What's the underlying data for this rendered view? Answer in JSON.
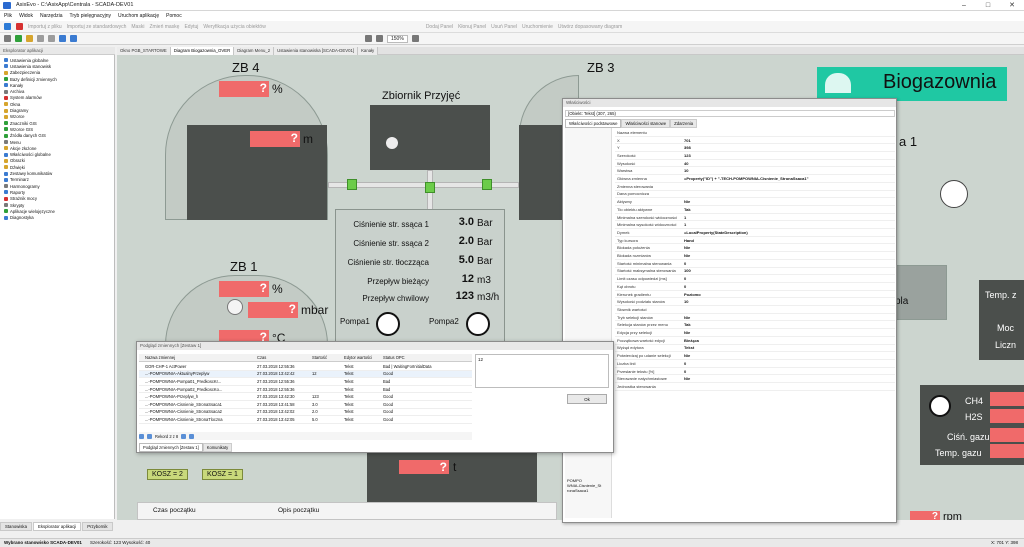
{
  "window": {
    "title": "AsixEvo - C:\\AsixApp\\Centrala - SCADA-DEV01"
  },
  "menu": [
    "Plik",
    "Widok",
    "Narzędzia",
    "Tryb pielęgnacyjny",
    "Uruchom aplikację",
    "Pomoc"
  ],
  "toolbar": {
    "import_from_file": "Importuj z pliku",
    "import_standard": "Importuj ze standardowych",
    "mask": "Maski",
    "change_mask": "Zmień maskę",
    "edit": "Edytuj",
    "verify": "Weryfikacja użycia obiektów",
    "dock_panel": "Dodaj Panel",
    "remove_panel": "Kłonuj Panel",
    "reset_panel": "Usuń Panel",
    "run": "Uruchomienie",
    "add_diagrams": "Utwórz dopasowany diagram",
    "zoom": "150%"
  },
  "left_panel": {
    "header": "Eksplorator aplikacji",
    "items": [
      "Ustawienia globalne",
      "Ustawienia stanowisk",
      "Zabezpieczenia",
      "Bazy definicji zmiennych",
      "Kanały",
      "Archiva",
      "System alarmów",
      "Okna",
      "Diagramy",
      "Wzorce",
      "Znaczniki GIS",
      "Wzorce GIS",
      "Źródła danych GIS",
      "Menu",
      "Akcje złożone",
      "Właściwości globalne",
      "Obrazki",
      "Dźwięki",
      "Zestawy komunikatów",
      "Terminarz",
      "Harmonogramy",
      "Raporty",
      "Strażnik mocy",
      "Skrypty",
      "Aplikacje wielojęzyczne",
      "Diagnostyka"
    ]
  },
  "tabs": [
    "Okno PGB_STARTOWE",
    "Diagram Biogazownia_OVER",
    "Diagram Menu_2",
    "Ustawienia stanowiska [SCADA-DEV01]",
    "Kanały"
  ],
  "scada": {
    "zb4": {
      "title": "ZB 4",
      "v1": "?",
      "u1": "%",
      "v2": "?",
      "u2": "m"
    },
    "zb3": {
      "title": "ZB 3",
      "v1": "?",
      "u1": "%"
    },
    "zb1": {
      "title": "ZB 1",
      "v1": "?",
      "u1": "%",
      "v2": "?",
      "u2": "mbar",
      "v3": "?",
      "u3": "°C"
    },
    "tank_title": "Zbiornik Przyjęć",
    "brand": "Biogazownia",
    "brand_right": "a 1",
    "rows": [
      {
        "label": "Ciśnienie str. ssąca 1",
        "value": "3.0",
        "unit": "Bar"
      },
      {
        "label": "Ciśnienie str. ssąca 2",
        "value": "2.0",
        "unit": "Bar"
      },
      {
        "label": "Ciśnienie str. tłoczząca",
        "value": "5.0",
        "unit": "Bar"
      },
      {
        "label": "Przepływ bieżący",
        "value": "12",
        "unit": "m3"
      },
      {
        "label": "Przepływ chwilowy",
        "value": "123",
        "unit": "m3/h"
      }
    ],
    "pump1": "Pompa1",
    "pump2": "Pompa2",
    "right_labels": [
      "Temp. z",
      "Moc",
      "Liczn",
      "CH4",
      "H2S",
      "Ciśń. gazu",
      "Temp. gazu",
      "pla"
    ],
    "kosz": [
      "KOSZ = 2",
      "KOSZ = 1",
      "KOSZ = 2"
    ],
    "bottom_table": {
      "col1": "Czas początku",
      "col2": "Opis początku"
    },
    "q": "?",
    "t": "t",
    "rpm": "rpm"
  },
  "props": {
    "title": "Właściwości",
    "object": "[Obiekt: Tekst] (307, 265)",
    "tabs": [
      "Właściwości podstawowe",
      "Właściwości stanowe",
      "Zdarzenia"
    ],
    "rows": [
      [
        "Nazwa elementu",
        ""
      ],
      [
        "X",
        "701"
      ],
      [
        "Y",
        "398"
      ],
      [
        "Szerokość",
        "123"
      ],
      [
        "Wysokość",
        "40"
      ],
      [
        "Warstwa",
        "10"
      ],
      [
        "Główna zmienna",
        "=Property(\"ID\") + \"-TECH-POMPOWNIA-Cisnienie_StronaSsaca1\""
      ],
      [
        "Zmienna sterowania",
        ""
      ],
      [
        "Dana pomocnicza",
        ""
      ],
      [
        "Aktywny",
        "Nie"
      ],
      [
        "Tło obiektu aktywne",
        "Tak"
      ],
      [
        "Minimalna szerokość widoczności",
        "1"
      ],
      [
        "Minimalna wysokość widoczności",
        "1"
      ],
      [
        "Dymek",
        "=LocalProperty(StateDescription)"
      ],
      [
        "Typ kursora",
        "Hand"
      ],
      [
        "Blokada położenia",
        "Nie"
      ],
      [
        "Blokada rozmiarów",
        "Nie"
      ],
      [
        "Startość minimalna sterowania",
        "0"
      ],
      [
        "Startość maksymalna sterowania",
        "100"
      ],
      [
        "Limit czasu odpowiedzi [ms]",
        "0"
      ],
      [
        "Kąt obrotu",
        "0"
      ],
      [
        "Kierunek gradientu",
        "Poziomo"
      ],
      [
        "Wysokość podziału stanów",
        "10"
      ],
      [
        "Słownik wartości",
        ""
      ],
      [
        "Tryb selekcji stanów",
        "Nie"
      ],
      [
        "Selekcja stanów przez menu",
        "Tak"
      ],
      [
        "Edycja przy selekcji",
        "Nie"
      ],
      [
        "Początkowa wartość edycji",
        "Bieżąca"
      ],
      [
        "Wyżąd edytora",
        "Tekst"
      ],
      [
        "Potwierdzaj po udanie selekcji",
        "Nie"
      ],
      [
        "Liczba linii",
        "0"
      ],
      [
        "Przesłanie tekstu [%]",
        "0"
      ],
      [
        "Sterowanie natychmiastowe",
        "Nie"
      ],
      [
        "Jednostka sterowania",
        ""
      ]
    ],
    "left_snip": "POMPO\nWNIA-Cisnienie_St\nronaSsaca1"
  },
  "vars": {
    "title": "Podgląd zmiennych [Zestaw 1]",
    "columns": [
      "Nazwa zmiennej",
      "Czas",
      "Startość",
      "Edytor wartości",
      "Status OPC"
    ],
    "rows": [
      [
        "GOR-CHP-1 ActPower",
        "27.03.2018 12:55:36",
        "",
        "Tekst",
        "Bad | WaitingForInitialData"
      ],
      [
        "...-POMPOWNIA-AktualnyPrzeplyw",
        "27.03.2018 13:42:42",
        "12",
        "Tekst",
        "Good"
      ],
      [
        "...-POMPOWNIA-Pompa01_PredkoscKr...",
        "27.03.2018 12:55:36",
        "",
        "Tekst",
        "Bad"
      ],
      [
        "...-POMPOWNIA-Pompa02_PredkoscKo...",
        "27.03.2018 12:55:36",
        "",
        "Tekst",
        "Bad"
      ],
      [
        "...-POMPOWNIA-Przeplyw_h",
        "27.03.2018 13:42:30",
        "123",
        "Tekst",
        "Good"
      ],
      [
        "...-POMPOWNIA-Cisnienie_StronaSsaca1",
        "27.03.2018 13:41:58",
        "3.0",
        "Tekst",
        "Good"
      ],
      [
        "...-POMPOWNIA-Cisnienie_StronaSsaca2",
        "27.03.2018 13:42:02",
        "2.0",
        "Tekst",
        "Good"
      ],
      [
        "...-POMPOWNIA-Cisnienie_StronaTloczna",
        "27.03.2018 13:42:05",
        "5.0",
        "Tekst",
        "Good"
      ]
    ],
    "record": "Rekord 2 z 8",
    "value_box": "12",
    "ok": "Ok",
    "bottom_tabs": [
      "Podgląd zmiennych [Zestaw 1]",
      "Komunikaty"
    ]
  },
  "bottom_tabs": [
    "Stanowiska",
    "Eksplorator aplikacji",
    "Przybornik"
  ],
  "status": {
    "left": "Wybrano stanowisko SCADA-DEV01",
    "mid": "Szerokość: 123 Wysokość: 40",
    "right": "X: 701 Y: 398"
  },
  "colors": {
    "canvas": "#ccd5cf",
    "red": "#f06a6a",
    "teal": "#1fc8a3",
    "dark": "#4b4f4c"
  }
}
